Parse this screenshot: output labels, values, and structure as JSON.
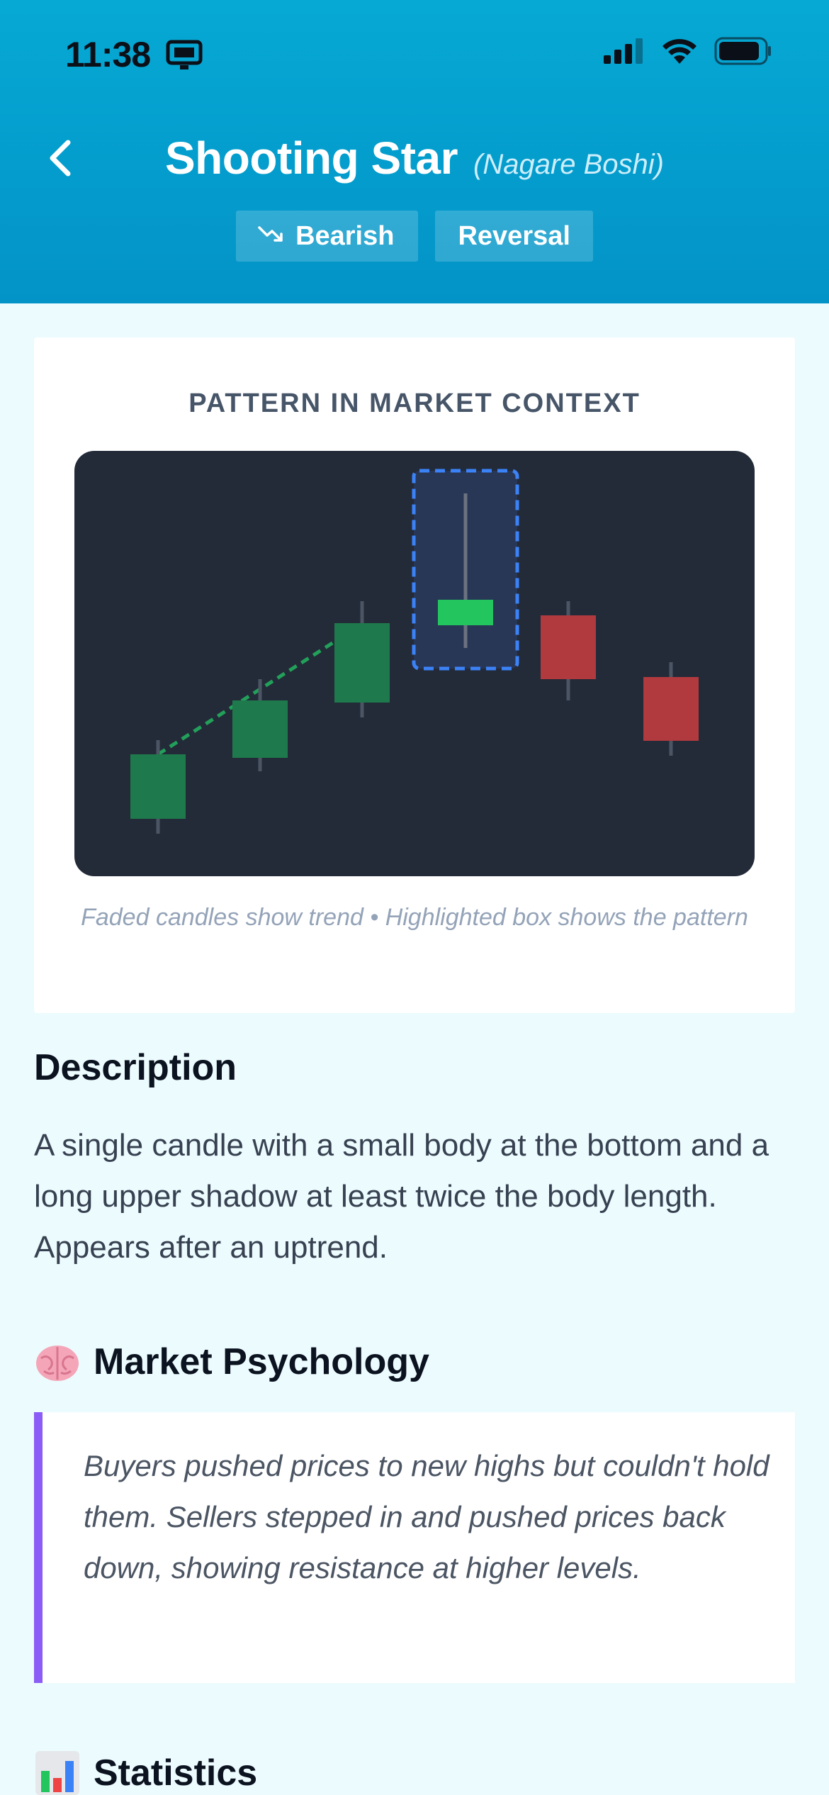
{
  "status_bar": {
    "time": "11:38",
    "icons": [
      "screen-mirroring-icon",
      "signal-icon",
      "wifi-icon",
      "battery-icon"
    ]
  },
  "header": {
    "back_icon": "chevron-left-icon",
    "title": "Shooting Star",
    "subtitle": "(Nagare Boshi)",
    "tags": [
      {
        "label": "Bearish",
        "icon": "trend-down-icon"
      },
      {
        "label": "Reversal"
      }
    ],
    "colors": {
      "gradient_top": "#06a9d4",
      "gradient_bottom": "#0393c7"
    }
  },
  "chart_card": {
    "title": "PATTERN IN MARKET CONTEXT",
    "caption": "Faded candles show trend • Highlighted box shows the pattern",
    "colors": {
      "background": "#232a38",
      "bullish_faded": "#1e7a4c",
      "bullish_pattern": "#22c55e",
      "bearish": "#b03a3e",
      "highlight_border": "#3b82f6",
      "trendline": "#22a05a"
    }
  },
  "description": {
    "heading": "Description",
    "text": "A single candle with a small body at the bottom and a long upper shadow at least twice the body length. Appears after an uptrend."
  },
  "psychology": {
    "heading": "Market Psychology",
    "icon": "brain-icon",
    "text": "Buyers pushed prices to new highs but couldn't hold them. Sellers stepped in and pushed prices back down, showing resistance at higher levels.",
    "accent": "#8b5cf6"
  },
  "statistics": {
    "heading": "Statistics",
    "icon": "bar-chart-icon"
  }
}
